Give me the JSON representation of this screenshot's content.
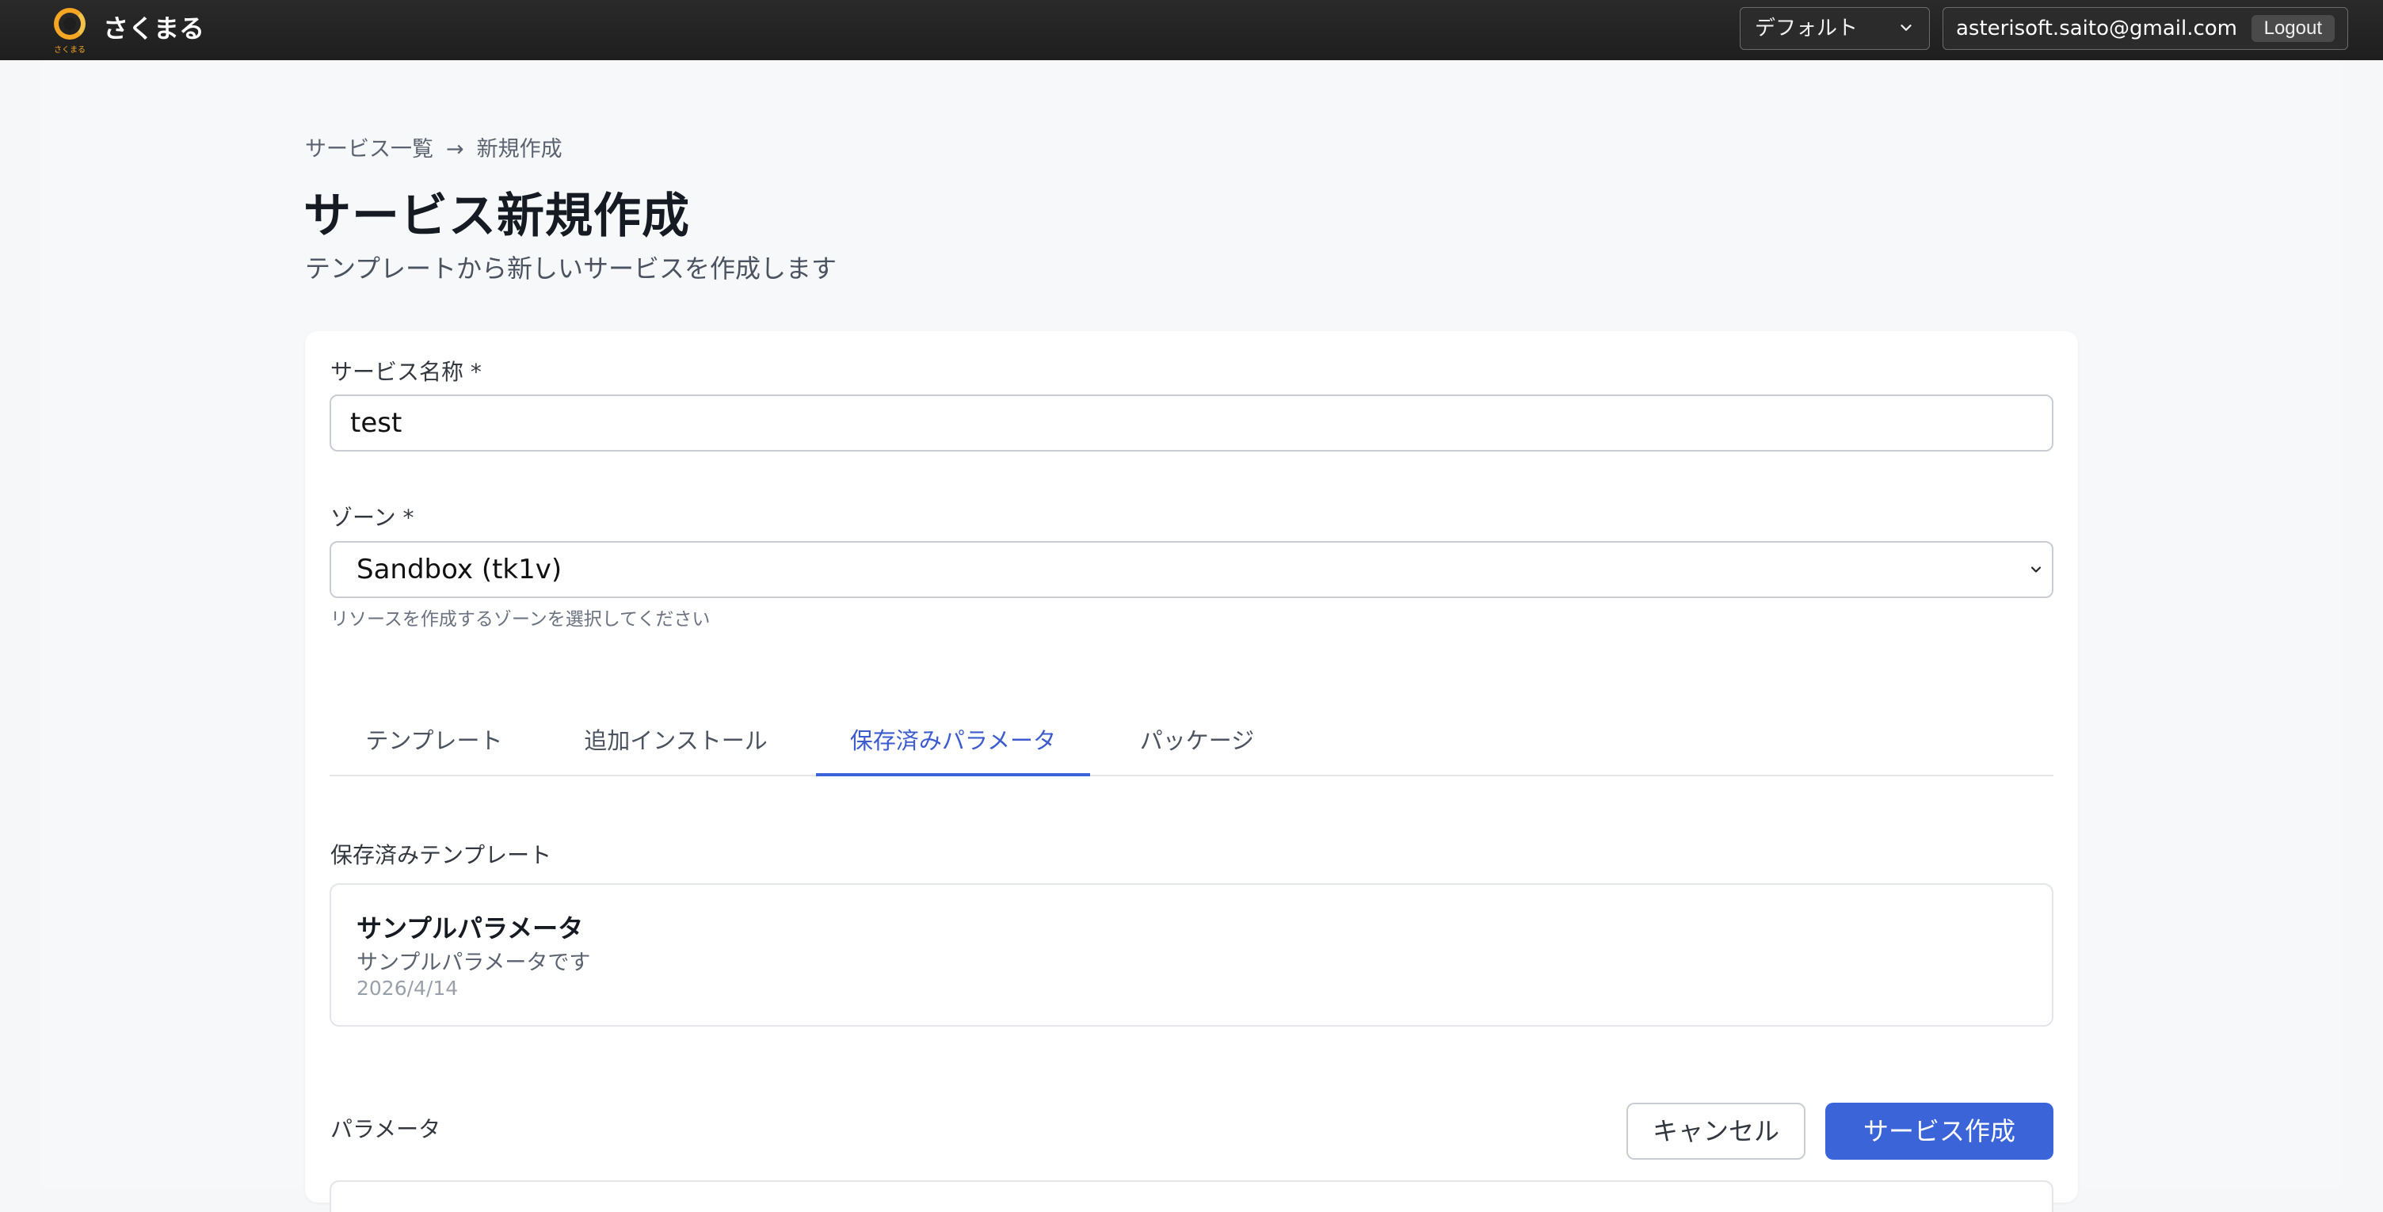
{
  "header": {
    "logo_sub": "さくまる",
    "brand": "さくまる",
    "org_selected": "デフォルト",
    "user_email": "asterisoft.saito@gmail.com",
    "logout_label": "Logout"
  },
  "breadcrumb": {
    "parent": "サービス一覧",
    "separator": "→",
    "current": "新規作成"
  },
  "page": {
    "title": "サービス新規作成",
    "subtitle": "テンプレートから新しいサービスを作成します"
  },
  "form": {
    "name_label": "サービス名称 *",
    "name_value": "test",
    "zone_label": "ゾーン *",
    "zone_selected": "Sandbox (tk1v)",
    "zone_help": "リソースを作成するゾーンを選択してください"
  },
  "tabs": [
    {
      "label": "テンプレート"
    },
    {
      "label": "追加インストール"
    },
    {
      "label": "保存済みパラメータ"
    },
    {
      "label": "パッケージ"
    }
  ],
  "active_tab": "保存済みパラメータ",
  "saved": {
    "section_label": "保存済みテンプレート",
    "items": [
      {
        "name": "サンプルパラメータ",
        "description": "サンプルパラメータです",
        "date": "2026/4/14"
      }
    ]
  },
  "params": {
    "label": "パラメータ"
  },
  "actions": {
    "cancel_label": "キャンセル",
    "create_label": "サービス作成"
  },
  "colors": {
    "accent": "#3b64d8",
    "header_bg": "#1e1e1e",
    "logo": "#f5a623"
  }
}
